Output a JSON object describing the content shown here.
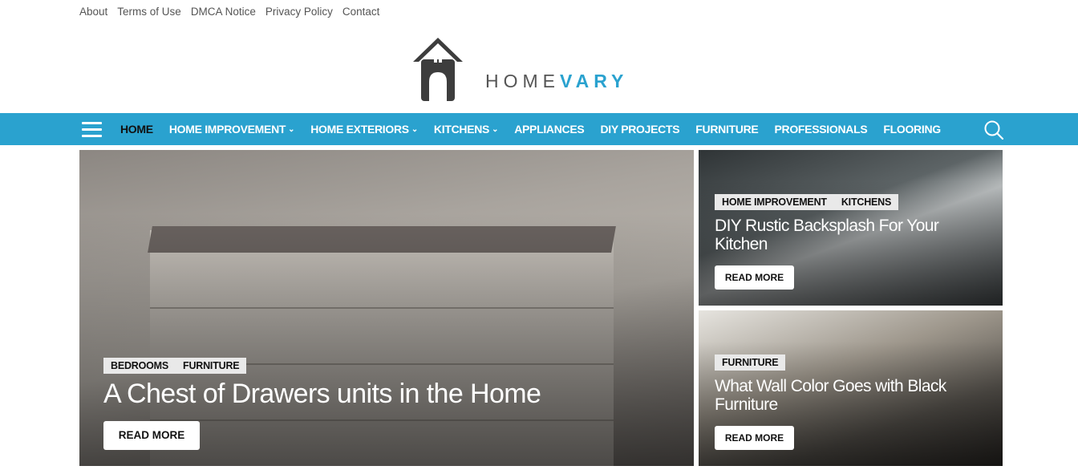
{
  "top_links": [
    "About",
    "Terms of Use",
    "DMCA Notice",
    "Privacy Policy",
    "Contact"
  ],
  "logo": {
    "part1": "HOME",
    "part2": "VARY",
    "icon": "house-logo-icon"
  },
  "nav": {
    "items": [
      {
        "label": "HOME",
        "active": true,
        "dropdown": false
      },
      {
        "label": "HOME IMPROVEMENT",
        "active": false,
        "dropdown": true
      },
      {
        "label": "HOME EXTERIORS",
        "active": false,
        "dropdown": true
      },
      {
        "label": "KITCHENS",
        "active": false,
        "dropdown": true
      },
      {
        "label": "APPLIANCES",
        "active": false,
        "dropdown": false
      },
      {
        "label": "DIY PROJECTS",
        "active": false,
        "dropdown": false
      },
      {
        "label": "FURNITURE",
        "active": false,
        "dropdown": false
      },
      {
        "label": "PROFESSIONALS",
        "active": false,
        "dropdown": false
      },
      {
        "label": "FLOORING",
        "active": false,
        "dropdown": false
      }
    ],
    "menu_icon": "hamburger-icon",
    "search_icon": "search-icon",
    "bar_color": "#2aa2cf"
  },
  "featured": {
    "main": {
      "tags": [
        "BEDROOMS",
        "FURNITURE"
      ],
      "title": "A Chest of Drawers units in the Home",
      "button": "READ MORE"
    },
    "side": [
      {
        "tags": [
          "HOME IMPROVEMENT",
          "KITCHENS"
        ],
        "title": "DIY Rustic Backsplash For Your Kitchen",
        "button": "READ MORE"
      },
      {
        "tags": [
          "FURNITURE"
        ],
        "title": "What Wall Color Goes with Black Furniture",
        "button": "READ MORE"
      }
    ]
  }
}
